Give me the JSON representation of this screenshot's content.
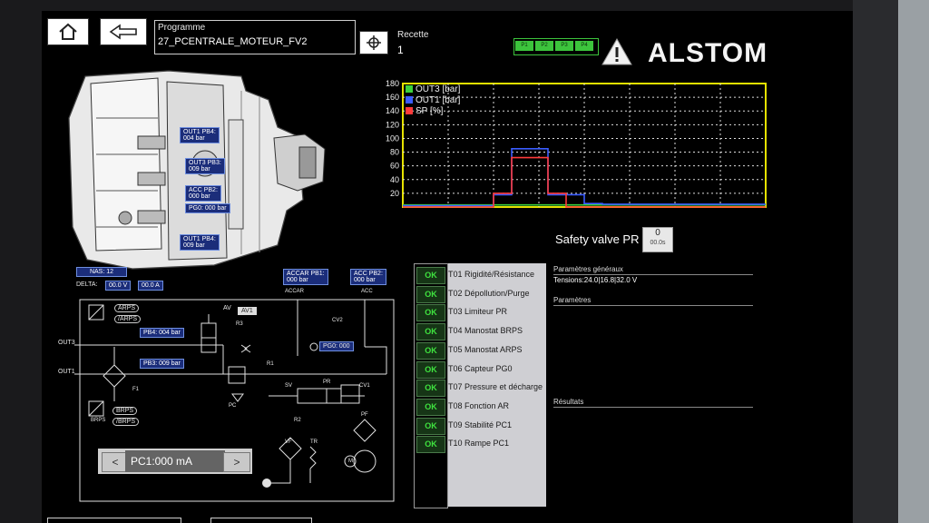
{
  "header": {
    "programme_label": "Programme",
    "programme_value": "27_PCENTRALE_MOTEUR_FV2",
    "recette_label": "Recette",
    "recette_value": "1",
    "phases": [
      "P1",
      "P2",
      "P3",
      "P4"
    ],
    "brand": "ALSTOM"
  },
  "chart_data": {
    "type": "line",
    "x": [
      0,
      5,
      10,
      15,
      20,
      25,
      30,
      35,
      40,
      45,
      50,
      55,
      60,
      65,
      70,
      75,
      80,
      85,
      90,
      95,
      100
    ],
    "ylim": [
      0,
      180
    ],
    "yticks": [
      20,
      40,
      60,
      80,
      100,
      120,
      140,
      160,
      180
    ],
    "grid": true,
    "legend_placement": "top-left",
    "series": [
      {
        "name": "OUT3 [bar]",
        "color": "#3cd23c",
        "values": [
          3,
          3,
          3,
          3,
          3,
          3,
          3,
          3,
          3,
          3,
          3,
          3,
          3,
          3,
          3,
          3,
          3,
          3,
          3,
          3,
          3
        ]
      },
      {
        "name": "OUT1 [bar]",
        "color": "#3a5cff",
        "values": [
          2,
          2,
          2,
          2,
          2,
          18,
          85,
          85,
          18,
          18,
          5,
          4,
          4,
          4,
          4,
          4,
          4,
          4,
          4,
          4,
          4
        ]
      },
      {
        "name": "SP [%]",
        "color": "#ff3a3a",
        "values": [
          0,
          0,
          0,
          0,
          0,
          20,
          72,
          72,
          20,
          0,
          0,
          0,
          0,
          0,
          0,
          0,
          0,
          0,
          0,
          0,
          0
        ]
      }
    ]
  },
  "safety": {
    "label": "Safety valve PR",
    "value": "0",
    "time": "00.0s"
  },
  "device_labels": {
    "out1_pb4": [
      "OUT1 PB4:",
      "004 bar"
    ],
    "out3_pb3": [
      "OUT3 PB3:",
      "009 bar"
    ],
    "acc_pb2": [
      "ACC PB2:",
      "000 bar"
    ],
    "pg0": "PG0: 000 bar",
    "out1_pb4_b": [
      "OUT1 PB4:",
      "009 bar"
    ],
    "nas": "NAS: 12",
    "delta_label": "DELTA:",
    "delta_v": "00.0 V",
    "delta_a": "00.0 A",
    "accar_pb1": [
      "ACCAR PB1:",
      "000 bar"
    ],
    "acc_pb2b": [
      "ACC PB2:",
      "000 bar"
    ],
    "accar": "ACCAR",
    "acc": "ACC"
  },
  "schematic": {
    "out3": "OUT3",
    "out1": "OUT1",
    "arps": "ARPS",
    "darps": "/ARPS",
    "brps": "BRPS",
    "dbrps": "/BRPS",
    "brps_lbl": "BRPS",
    "av": "AV",
    "av1": "AV1",
    "r3": "R3",
    "cv2": "CV2",
    "pb4": "PB4: 004 bar",
    "pb3": "PB3: 009 bar",
    "pg0": "PG0: 000",
    "r1": "R1",
    "f1": "F1",
    "pc": "PC",
    "sv": "SV",
    "pr": "PR",
    "cv1": "CV1",
    "r2": "R2",
    "pf": "PF",
    "vf": "VF",
    "tr": "TR",
    "m": "M"
  },
  "pc_control": {
    "left": "<",
    "value": "PC1:000 mA",
    "right": ">"
  },
  "tests": [
    {
      "status": "OK",
      "label": "T01 Rigidité/Résistance"
    },
    {
      "status": "OK",
      "label": "T02 Dépollution/Purge"
    },
    {
      "status": "OK",
      "label": "T03 Limiteur PR"
    },
    {
      "status": "OK",
      "label": "T04 Manostat BRPS"
    },
    {
      "status": "OK",
      "label": "T05 Manostat ARPS"
    },
    {
      "status": "OK",
      "label": "T06 Capteur PG0"
    },
    {
      "status": "OK",
      "label": "T07 Pressure et décharge"
    },
    {
      "status": "OK",
      "label": "T08 Fonction AR"
    },
    {
      "status": "OK",
      "label": "T09 Stabilité PC1"
    },
    {
      "status": "OK",
      "label": "T10 Rampe PC1"
    }
  ],
  "params": {
    "general_title": "Paramètres généraux",
    "tensions": "Tensions:24.0|16.8|32.0 V",
    "params_title": "Paramètres",
    "results_title": "Résultats"
  },
  "colors": {
    "ok_green": "#3fe33f",
    "label_blue": "#1b2d7a",
    "screen_bg": "#000000"
  }
}
